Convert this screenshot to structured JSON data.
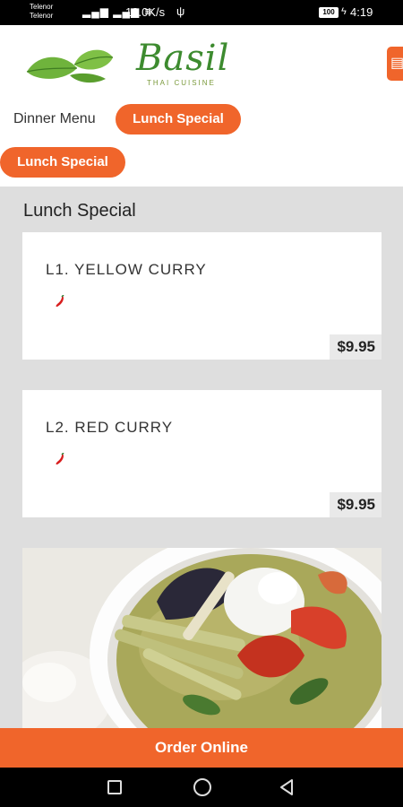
{
  "status_bar": {
    "carrier_1": "Telenor",
    "carrier_2": "Telenor",
    "net_speed": "12.0K/s",
    "battery": "100",
    "time": "4:19"
  },
  "logo": {
    "name": "Basil",
    "tagline": "THAI CUISINE"
  },
  "tabs": {
    "dinner": "Dinner Menu",
    "lunch": "Lunch Special"
  },
  "category_chip": "Lunch Special",
  "section": {
    "title": "Lunch Special"
  },
  "items": [
    {
      "name": "L1. YELLOW CURRY",
      "price": "$9.95",
      "spicy_icon": "chili-pepper-icon"
    },
    {
      "name": "L2. RED CURRY",
      "price": "$9.95",
      "spicy_icon": "chili-pepper-icon"
    }
  ],
  "order_button": "Order Online",
  "colors": {
    "accent": "#f0652b",
    "logo_green": "#3d8b2f",
    "background": "#dedede",
    "chili": "#d81e1e"
  }
}
